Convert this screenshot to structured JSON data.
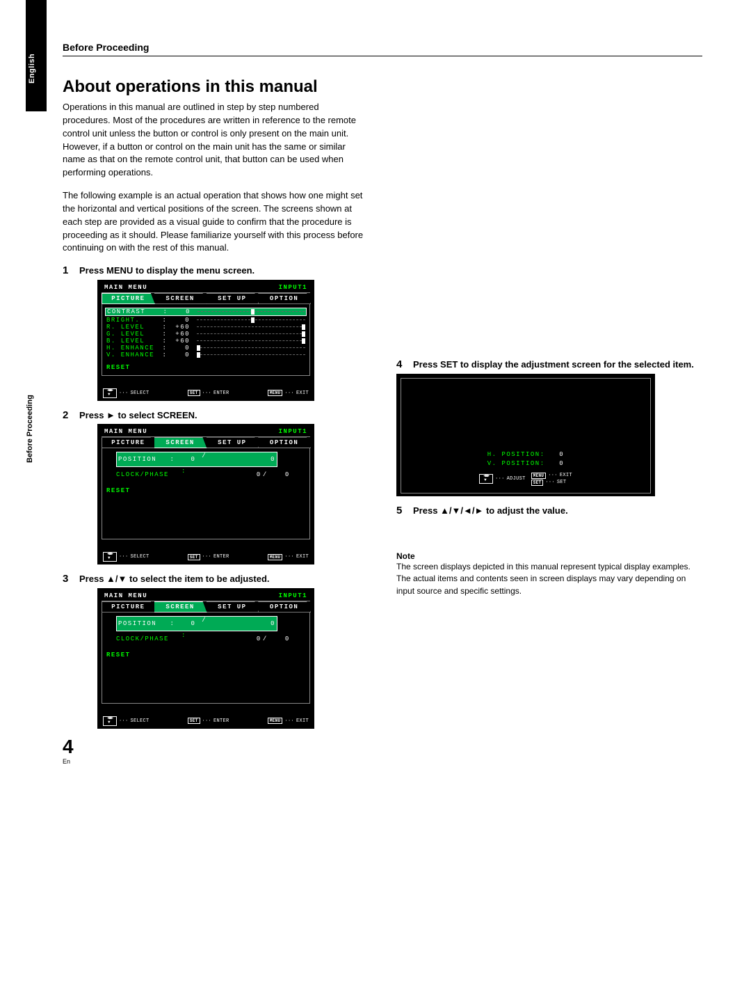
{
  "header": {
    "section": "Before Proceeding"
  },
  "sidebar": {
    "lang": "English",
    "section": "Before Proceeding"
  },
  "title": "About operations in this manual",
  "para1": "Operations in this manual are outlined in step by step numbered procedures. Most of the procedures are written in reference to the remote control unit unless the button or control is only present on the main unit. However, if a button or control on the main unit has the same or similar name as that on the remote control unit, that button can be used when performing operations.",
  "para2": "The following example is an actual operation that shows how one might set the horizontal and vertical positions of the screen. The screens shown at each step are provided as a visual guide to confirm that the procedure is proceeding as it should. Please familiarize yourself with this process before continuing on with the rest of this manual.",
  "steps": {
    "s1": {
      "num": "1",
      "text": "Press MENU to display the menu screen."
    },
    "s2": {
      "num": "2",
      "text": "Press ► to select SCREEN."
    },
    "s3": {
      "num": "3",
      "text": "Press ▲/▼ to select the item to be adjusted."
    },
    "s4": {
      "num": "4",
      "text": "Press SET to display the adjustment screen for the selected item."
    },
    "s5": {
      "num": "5",
      "text": "Press ▲/▼/◄/► to adjust the value."
    }
  },
  "osd": {
    "title": "MAIN MENU",
    "input": "INPUT1",
    "tabs": {
      "picture": "PICTURE",
      "screen": "SCREEN",
      "setup": "SET UP",
      "option": "OPTION"
    },
    "picture_rows": {
      "contrast": {
        "label": "CONTRAST",
        "value": "0",
        "tick": 50
      },
      "bright": {
        "label": "BRIGHT.",
        "value": "0",
        "tick": 50
      },
      "rlevel": {
        "label": "R. LEVEL",
        "value": "+60",
        "tick": 100
      },
      "glevel": {
        "label": "G. LEVEL",
        "value": "+60",
        "tick": 100
      },
      "blevel": {
        "label": "B. LEVEL",
        "value": "+60",
        "tick": 100
      },
      "henh": {
        "label": "H. ENHANCE",
        "value": "0",
        "tick": 0
      },
      "venh": {
        "label": "V. ENHANCE",
        "value": "0",
        "tick": 0
      }
    },
    "screen_rows": {
      "position": {
        "label": "POSITION",
        "v1": "0",
        "v2": "0"
      },
      "clock": {
        "label": "CLOCK/PHASE",
        "v1": "0",
        "v2": "0"
      }
    },
    "reset": "RESET",
    "footer": {
      "select": "SELECT",
      "enter": "ENTER",
      "exit": "EXIT",
      "adjust": "ADJUST",
      "set": "SET",
      "menu": "MENU",
      "setkey": "SET"
    },
    "adjust": {
      "h": {
        "label": "H. POSITION:",
        "value": "0"
      },
      "v": {
        "label": "V. POSITION:",
        "value": "0"
      }
    }
  },
  "note": {
    "head": "Note",
    "line1": "The screen displays depicted in this manual represent typical display examples.",
    "line2": "The actual items and contents seen in screen displays may vary depending on input source and specific settings."
  },
  "page": {
    "num": "4",
    "lang": "En"
  }
}
